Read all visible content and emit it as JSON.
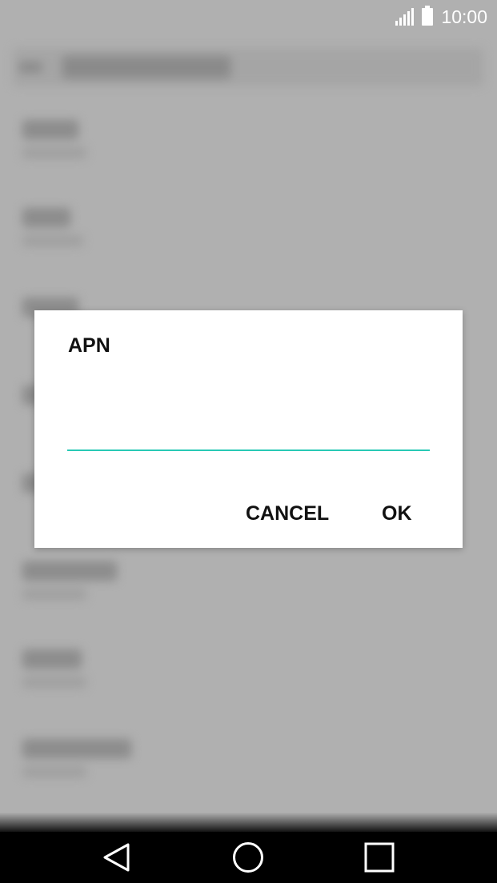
{
  "status_bar": {
    "time": "10:00",
    "signal_icon": "cell-signal-icon",
    "battery_icon": "battery-full-icon"
  },
  "dialog": {
    "title": "APN",
    "input_value": "",
    "cancel_label": "CANCEL",
    "ok_label": "OK",
    "accent_color": "#28c9b5"
  },
  "nav_bar": {
    "back_icon": "back-triangle-icon",
    "home_icon": "home-circle-icon",
    "recents_icon": "recents-square-icon"
  }
}
